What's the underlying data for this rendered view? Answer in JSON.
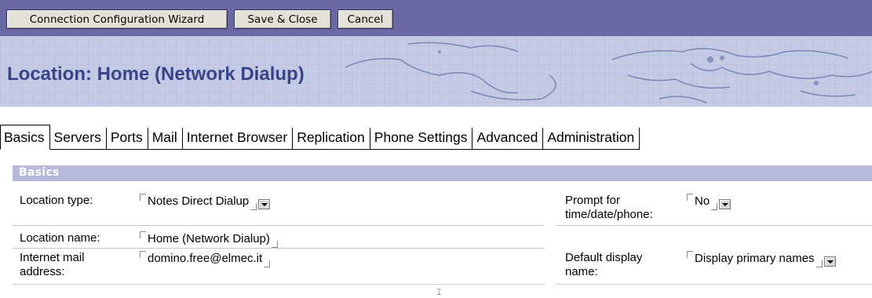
{
  "toolbar": {
    "buttons": [
      {
        "label": "Connection Configuration Wizard"
      },
      {
        "label": "Save & Close"
      },
      {
        "label": "Cancel"
      }
    ]
  },
  "banner": {
    "title": "Location: Home (Network Dialup)"
  },
  "tabs": [
    {
      "label": "Basics",
      "active": true
    },
    {
      "label": "Servers"
    },
    {
      "label": "Ports"
    },
    {
      "label": "Mail"
    },
    {
      "label": "Internet Browser"
    },
    {
      "label": "Replication"
    },
    {
      "label": "Phone Settings"
    },
    {
      "label": "Advanced"
    },
    {
      "label": "Administration"
    }
  ],
  "section": {
    "title": "Basics"
  },
  "fields": {
    "location_type": {
      "label": "Location type:",
      "value": "Notes Direct Dialup"
    },
    "location_name": {
      "label": "Location name:",
      "value": "Home (Network Dialup)"
    },
    "internet_mail": {
      "label_line1": "Internet mail",
      "label_line2": "address:",
      "value": "domino.free@elmec.it"
    },
    "prompt": {
      "label_line1": "Prompt for",
      "label_line2": "time/date/phone:",
      "value": "No"
    },
    "default_display": {
      "label_line1": "Default display",
      "label_line2": "name:",
      "value": "Display primary names"
    }
  },
  "colors": {
    "toolbar_bg": "#6a69a6",
    "banner_title": "#37448a",
    "section_bar": "#b7b9db"
  }
}
